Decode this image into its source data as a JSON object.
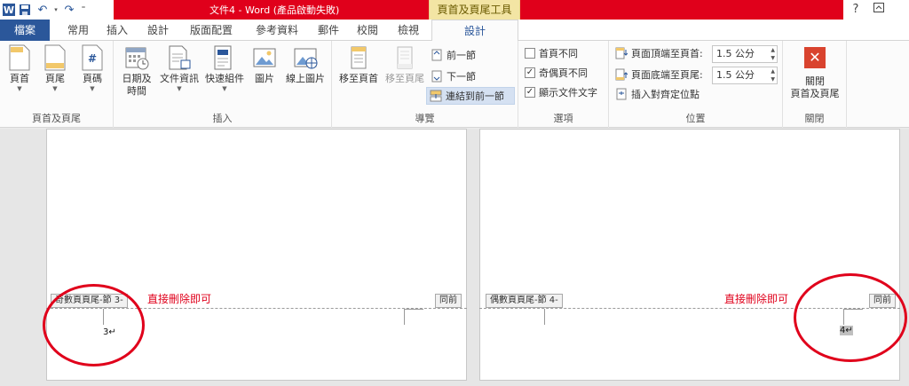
{
  "titlebar": {
    "doc_title": "文件4 - Word (產品啟動失敗)",
    "context_tab_title": "頁首及頁尾工具",
    "help": "?",
    "restore": "⧉"
  },
  "qat": {
    "word": "W",
    "save": "💾",
    "undo": "↶",
    "redo": "↷",
    "more": "⁼"
  },
  "tabs": {
    "file": "檔案",
    "home": "常用",
    "insert": "插入",
    "design": "設計",
    "layout": "版面配置",
    "references": "參考資料",
    "mailings": "郵件",
    "review": "校閱",
    "view": "檢視",
    "hf_design": "設計"
  },
  "ribbon": {
    "hf_group": {
      "label": "頁首及頁尾",
      "header": "頁首",
      "footer": "頁尾",
      "page_number": "頁碼"
    },
    "insert_group": {
      "label": "插入",
      "datetime_1": "日期及",
      "datetime_2": "時間",
      "docinfo": "文件資訊",
      "quickparts": "快速組件",
      "picture": "圖片",
      "online_picture": "線上圖片"
    },
    "nav_group": {
      "label": "導覽",
      "goto_header": "移至頁首",
      "goto_footer": "移至頁尾",
      "prev": "前一節",
      "next": "下一節",
      "link_prev": "連結到前一節"
    },
    "options_group": {
      "label": "選項",
      "first_diff": "首頁不同",
      "oddeven_diff": "奇偶頁不同",
      "show_text": "顯示文件文字",
      "first_checked": "",
      "oddeven_checked": "✓",
      "show_checked": "✓"
    },
    "position_group": {
      "label": "位置",
      "header_top": "頁面頂端至頁首:",
      "header_top_val": "1.5 公分",
      "footer_bottom": "頁面底端至頁尾:",
      "footer_bottom_val": "1.5 公分",
      "align_tab": "插入對齊定位點"
    },
    "close_group": {
      "label": "關閉",
      "close_1": "關閉",
      "close_2": "頁首及頁尾",
      "close_icon": "✕"
    }
  },
  "document": {
    "left_page": {
      "footer_tag": "奇數頁頁尾-節 3-",
      "same_as_prev": "同前",
      "note": "直接刪除即可",
      "page_number": "3↵"
    },
    "right_page": {
      "footer_tag": "偶數頁頁尾-節 4-",
      "same_as_prev": "同前",
      "note": "直接刪除即可",
      "page_number": "4↵"
    }
  },
  "colors": {
    "accent": "#2b579a",
    "titlebar_red": "#e0001b",
    "context_yellow": "#f3e5a4",
    "annotation_red": "#e0001b"
  }
}
